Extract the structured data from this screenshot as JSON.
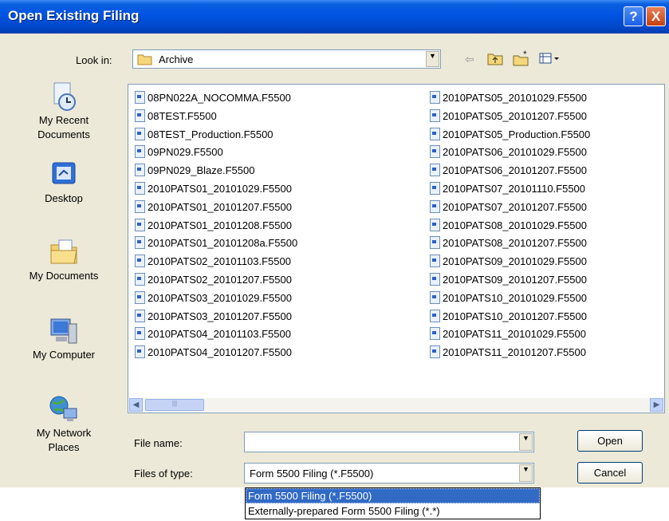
{
  "window": {
    "title": "Open Existing Filing",
    "help_label": "?",
    "close_label": "X"
  },
  "lookin": {
    "label": "Look in:",
    "value": "Archive"
  },
  "places": [
    {
      "name": "My Recent Documents",
      "l1": "My Recent",
      "l2": "Documents",
      "icon": "recent-documents-icon"
    },
    {
      "name": "Desktop",
      "l1": "Desktop",
      "l2": "",
      "icon": "desktop-icon"
    },
    {
      "name": "My Documents",
      "l1": "My Documents",
      "l2": "",
      "icon": "my-documents-icon"
    },
    {
      "name": "My Computer",
      "l1": "My Computer",
      "l2": "",
      "icon": "my-computer-icon"
    },
    {
      "name": "My Network Places",
      "l1": "My Network",
      "l2": "Places",
      "icon": "network-places-icon"
    }
  ],
  "files_left": [
    "08PN022A_NOCOMMA.F5500",
    "08TEST.F5500",
    "08TEST_Production.F5500",
    "09PN029.F5500",
    "09PN029_Blaze.F5500",
    "2010PATS01_20101029.F5500",
    "2010PATS01_20101207.F5500",
    "2010PATS01_20101208.F5500",
    "2010PATS01_20101208a.F5500",
    "2010PATS02_20101103.F5500",
    "2010PATS02_20101207.F5500",
    "2010PATS03_20101029.F5500",
    "2010PATS03_20101207.F5500",
    "2010PATS04_20101103.F5500",
    "2010PATS04_20101207.F5500"
  ],
  "files_right": [
    "2010PATS05_20101029.F5500",
    "2010PATS05_20101207.F5500",
    "2010PATS05_Production.F5500",
    "2010PATS06_20101029.F5500",
    "2010PATS06_20101207.F5500",
    "2010PATS07_20101110.F5500",
    "2010PATS07_20101207.F5500",
    "2010PATS08_20101029.F5500",
    "2010PATS08_20101207.F5500",
    "2010PATS09_20101029.F5500",
    "2010PATS09_20101207.F5500",
    "2010PATS10_20101029.F5500",
    "2010PATS10_20101207.F5500",
    "2010PATS11_20101029.F5500",
    "2010PATS11_20101207.F5500"
  ],
  "filename": {
    "label": "File name:",
    "value": ""
  },
  "filetype": {
    "label": "Files of type:",
    "value": "Form 5500 Filing (*.F5500)",
    "options": [
      "Form 5500 Filing (*.F5500)",
      "Externally-prepared Form 5500 Filing (*.*)"
    ]
  },
  "buttons": {
    "open": "Open",
    "cancel": "Cancel"
  }
}
